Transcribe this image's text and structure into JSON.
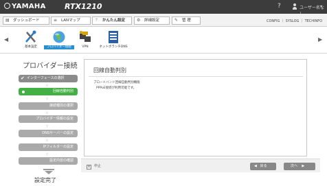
{
  "titlebar": {
    "brand": "YAMAHA",
    "product": "RTX1210",
    "help": "?",
    "username": "ユーザー名なし",
    "chevron": "▾"
  },
  "menubar": {
    "tabs": [
      {
        "label": "ダッシュボード",
        "icon": "dashboard-icon"
      },
      {
        "label": "LANマップ",
        "icon": "lanmap-icon"
      },
      {
        "label": "かんたん設定",
        "icon": "wand-icon",
        "active": true
      },
      {
        "label": "詳細設定",
        "icon": "gear-icon"
      },
      {
        "label": "管 理",
        "icon": "wrench-icon"
      }
    ],
    "right_links": "CONFIG ｜ SYSLOG ｜ TECHINFO"
  },
  "toolbar": {
    "items": [
      {
        "label": "基本設定",
        "icon": "tools-icon"
      },
      {
        "label": "プロバイダー接続",
        "icon": "globe-icon",
        "active": true
      },
      {
        "label": "VPN",
        "icon": "vpn-icon"
      },
      {
        "label": "ネットボランチDNS",
        "icon": "dns-icon"
      }
    ]
  },
  "wizard": {
    "title": "プロバイダー接続",
    "steps": [
      {
        "label": "インターフェースの選択",
        "state": "done"
      },
      {
        "label": "回線自動判別",
        "state": "current"
      },
      {
        "label": "接続種別の選択",
        "state": "pending"
      },
      {
        "label": "プロバイダー情報の設定",
        "state": "pending"
      },
      {
        "label": "DNSサーバーの設定",
        "state": "pending"
      },
      {
        "label": "IPフィルターの設定",
        "state": "pending"
      },
      {
        "label": "設定内容の確認",
        "state": "pending"
      }
    ],
    "finish": "設定完了"
  },
  "panel": {
    "title": "回線自動判別",
    "line1": "ブロードバンド回線自動判別機能",
    "line2": "PPPoE接続が利用可能です。"
  },
  "footer": {
    "cancel": "中止",
    "back": "戻る",
    "next": "次へ"
  },
  "colors": {
    "titlebar": "#3c3c3c",
    "active_step": "#43b043",
    "active_tab": "#2a8fce"
  }
}
